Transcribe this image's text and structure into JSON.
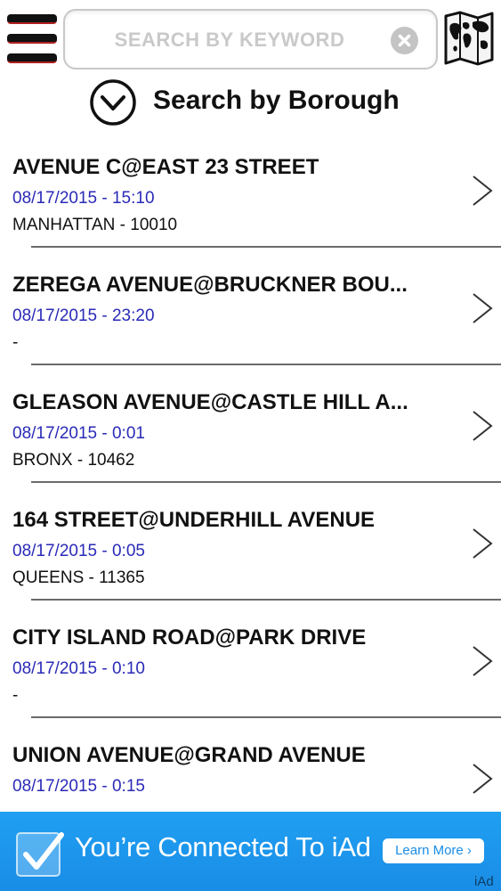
{
  "header": {
    "menu_icon": "hamburger-menu-icon",
    "search": {
      "placeholder": "SEARCH BY KEYWORD",
      "value": ""
    },
    "clear_icon": "clear-circle-icon",
    "map_icon": "world-map-icon"
  },
  "borough_selector": {
    "icon": "chevron-down-circle-icon",
    "label": "Search by Borough"
  },
  "items": [
    {
      "title": "AVENUE C@EAST 23 STREET",
      "datetime": "08/17/2015 - 15:10",
      "location": "MANHATTAN - 10010"
    },
    {
      "title": "ZEREGA AVENUE@BRUCKNER BOU...",
      "datetime": "08/17/2015 - 23:20",
      "location": "-"
    },
    {
      "title": "GLEASON AVENUE@CASTLE HILL A...",
      "datetime": "08/17/2015 - 0:01",
      "location": "BRONX - 10462"
    },
    {
      "title": "164 STREET@UNDERHILL AVENUE",
      "datetime": "08/17/2015 - 0:05",
      "location": "QUEENS - 11365"
    },
    {
      "title": "CITY ISLAND ROAD@PARK DRIVE",
      "datetime": "08/17/2015 - 0:10",
      "location": "-"
    },
    {
      "title": "UNION AVENUE@GRAND AVENUE",
      "datetime": "08/17/2015 - 0:15",
      "location": ""
    }
  ],
  "ad": {
    "icon": "checkmark-icon",
    "text": "You’re Connected To iAd",
    "learn_more": "Learn More ›",
    "brand": "iAd"
  },
  "colors": {
    "date_text": "#2a2ab8",
    "ad_background": "#1a8de6",
    "divider": "#6b6b6b"
  }
}
